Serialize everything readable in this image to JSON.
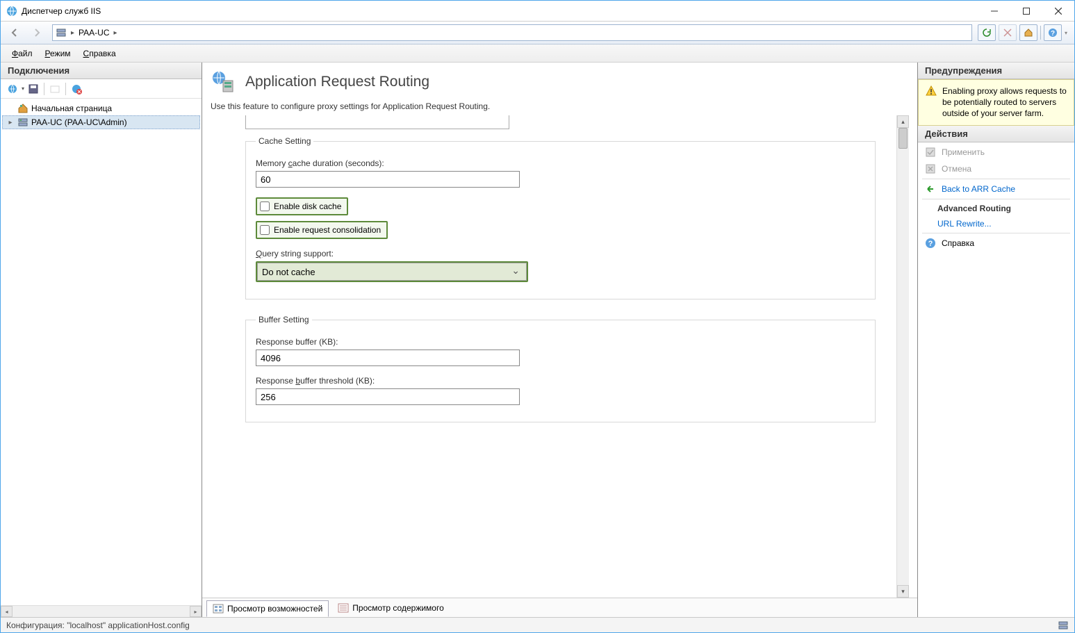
{
  "window": {
    "title": "Диспетчер служб IIS"
  },
  "address": {
    "node": "PAA-UC"
  },
  "menu": {
    "file": "Файл",
    "mode": "Режим",
    "help": "Справка"
  },
  "left": {
    "header": "Подключения",
    "start_page": "Начальная страница",
    "server": "PAA-UC (PAA-UC\\Admin)"
  },
  "center": {
    "title": "Application Request Routing",
    "desc": "Use this feature to configure proxy settings for Application Request Routing.",
    "cache_legend": "Cache Setting",
    "mem_cache_label_pre": "Memory ",
    "mem_cache_label_u": "c",
    "mem_cache_label_post": "ache duration (seconds):",
    "mem_cache_value": "60",
    "enable_disk_pre": "",
    "enable_disk_u": "E",
    "enable_disk_post": "nable disk cache",
    "enable_req_pre": "Enable re",
    "enable_req_u": "q",
    "enable_req_post": "uest consolidation",
    "query_label_pre": "",
    "query_label_u": "Q",
    "query_label_post": "uery string support:",
    "query_value": "Do not cache",
    "buffer_legend": "Buffer Setting",
    "resp_buf_label": "Response buffer (KB):",
    "resp_buf_value": "4096",
    "resp_thresh_pre": "Response ",
    "resp_thresh_u": "b",
    "resp_thresh_post": "uffer threshold (KB):",
    "resp_thresh_value": "256",
    "tab_features": "Просмотр возможностей",
    "tab_content": "Просмотр содержимого"
  },
  "right": {
    "warn_header": "Предупреждения",
    "warn_text": "Enabling proxy allows requests to be potentially routed to servers outside of your server farm.",
    "actions_header": "Действия",
    "apply": "Применить",
    "cancel": "Отмена",
    "back": "Back to ARR Cache",
    "adv": "Advanced Routing",
    "urlrw": "URL Rewrite...",
    "help": "Справка"
  },
  "status": {
    "text": "Конфигурация: \"localhost\" applicationHost.config"
  }
}
